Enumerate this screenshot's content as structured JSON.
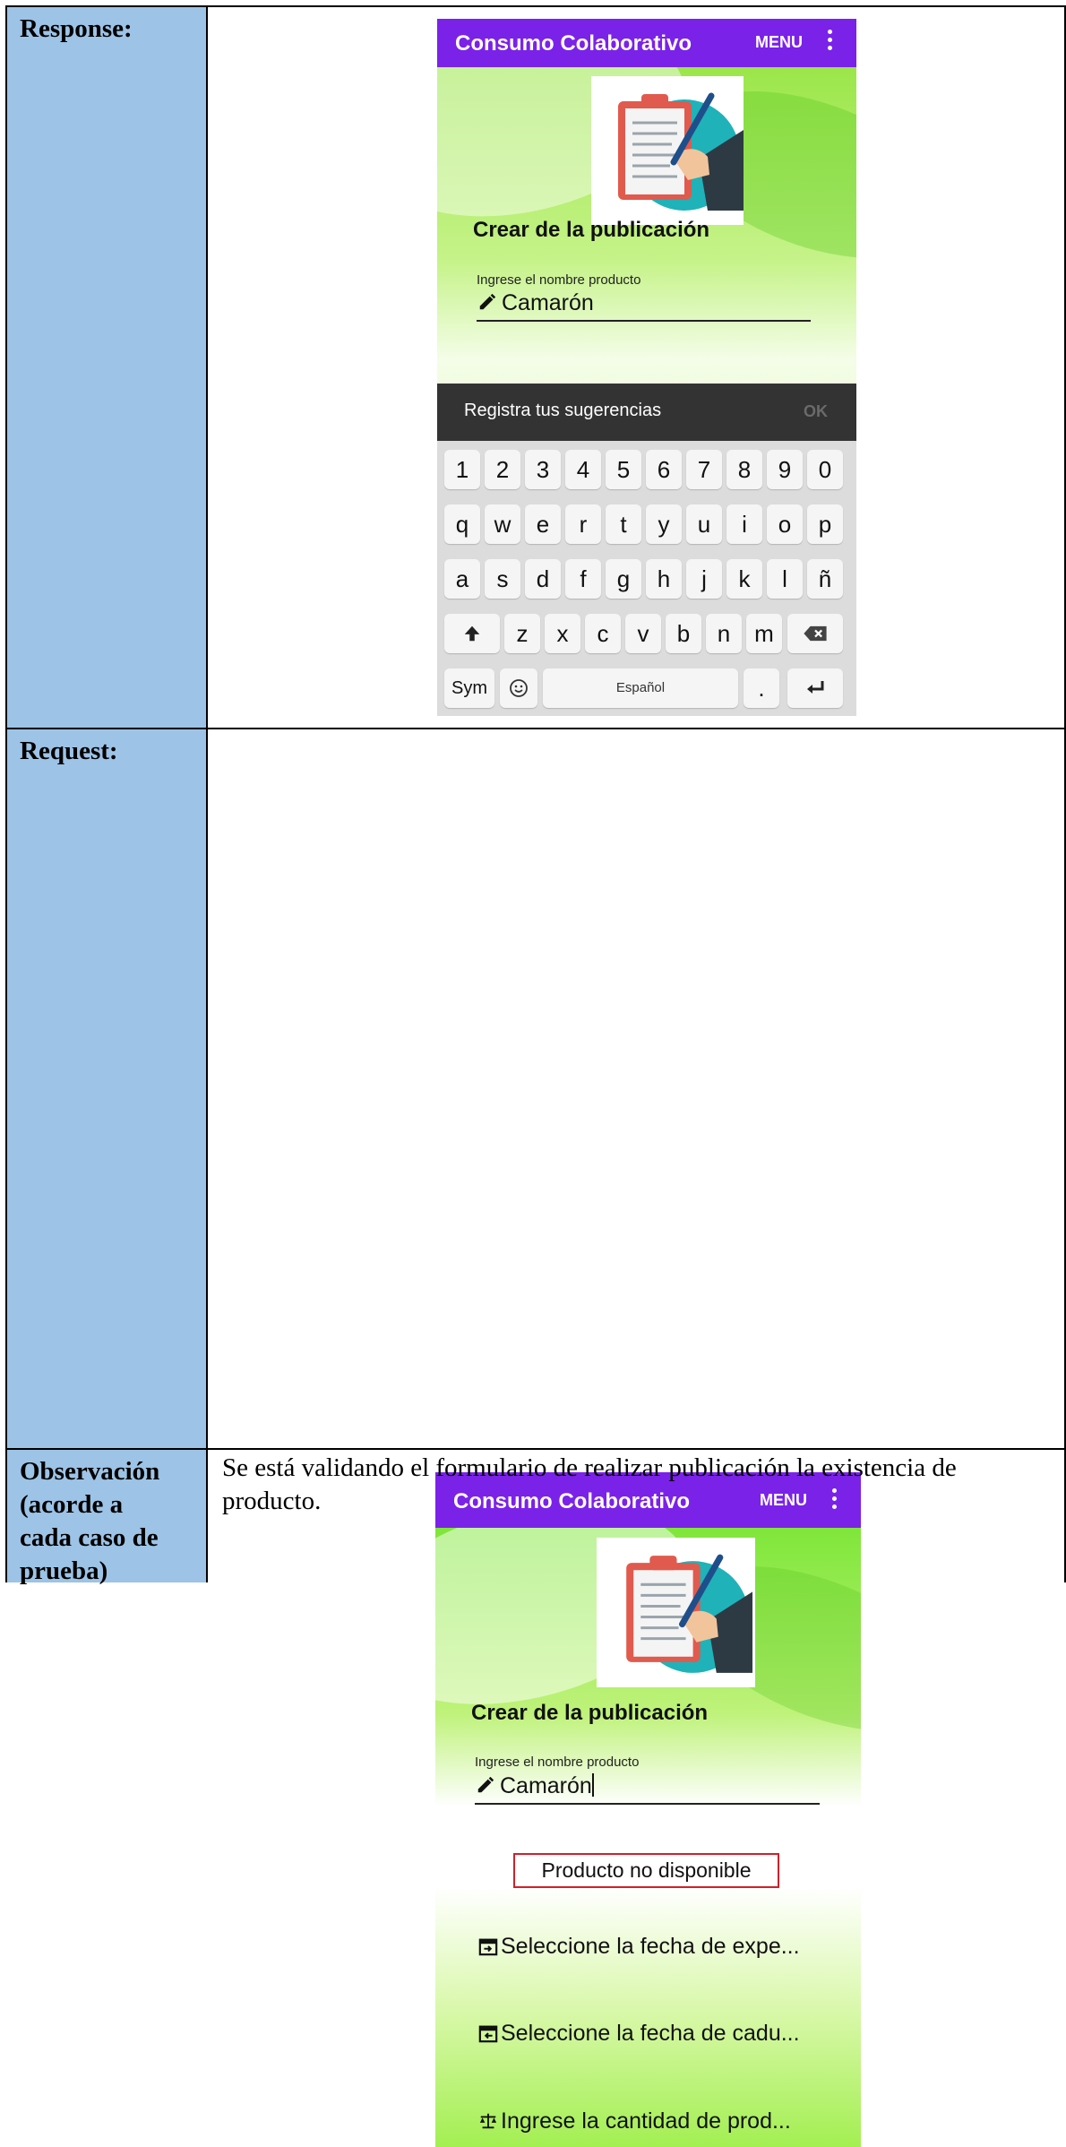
{
  "table": {
    "response_label": "Response:",
    "request_label": "Request:",
    "observation_label_lines": [
      "Observación",
      "(acorde a",
      "cada caso de",
      "prueba)"
    ],
    "observation_text": "Se está validando el formulario de realizar publicación la existencia de producto."
  },
  "response_screen": {
    "app_title": "Consumo Colaborativo",
    "menu_label": "MENU",
    "form_title": "Crear de la publicación",
    "field_label": "Ingrese el nombre producto",
    "field_value": "Camarón",
    "suggestion_text": "Registra tus sugerencias",
    "suggestion_ok": "OK",
    "keyboard": {
      "row_numbers": [
        "1",
        "2",
        "3",
        "4",
        "5",
        "6",
        "7",
        "8",
        "9",
        "0"
      ],
      "row_top": [
        "q",
        "w",
        "e",
        "r",
        "t",
        "y",
        "u",
        "i",
        "o",
        "p"
      ],
      "row_middle": [
        "a",
        "s",
        "d",
        "f",
        "g",
        "h",
        "j",
        "k",
        "l",
        "ñ"
      ],
      "row_bottom": [
        "z",
        "x",
        "c",
        "v",
        "b",
        "n",
        "m"
      ],
      "sym_label": "Sym",
      "space_label": "Español",
      "period_label": "."
    }
  },
  "request_screen": {
    "app_title": "Consumo Colaborativo",
    "menu_label": "MENU",
    "form_title": "Crear de la publicación",
    "field_label": "Ingrese el nombre producto",
    "field_value": "Camarón",
    "error_message": "Producto no disponible",
    "expedition_date_placeholder": "Seleccione la fecha de expe...",
    "expiry_date_placeholder": "Seleccione la fecha de cadu...",
    "quantity_placeholder": "Ingrese la cantidad de prod..."
  },
  "colors": {
    "table_label_bg": "#9dc3e6",
    "appbar": "#7b22e8",
    "error_border": "#d0202a"
  }
}
